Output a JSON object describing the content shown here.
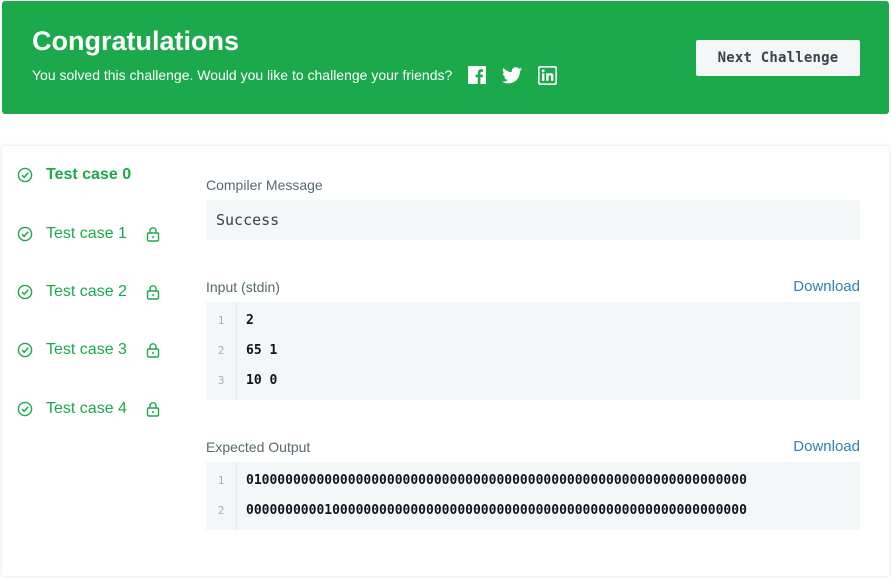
{
  "banner": {
    "title": "Congratulations",
    "subtitle": "You solved this challenge. Would you like to challenge your friends?",
    "social_icons": [
      "facebook-icon",
      "twitter-icon",
      "linkedin-icon"
    ],
    "next_button": "Next Challenge",
    "bg_color": "#1ba94c"
  },
  "test_cases": [
    {
      "label": "Test case 0",
      "active": true,
      "locked": false
    },
    {
      "label": "Test case 1",
      "active": false,
      "locked": true
    },
    {
      "label": "Test case 2",
      "active": false,
      "locked": true
    },
    {
      "label": "Test case 3",
      "active": false,
      "locked": true
    },
    {
      "label": "Test case 4",
      "active": false,
      "locked": true
    }
  ],
  "compiler": {
    "label": "Compiler Message",
    "message": "Success"
  },
  "input": {
    "label": "Input (stdin)",
    "download": "Download",
    "lines": [
      {
        "n": "1",
        "text": "2"
      },
      {
        "n": "2",
        "text": "65 1"
      },
      {
        "n": "3",
        "text": "10 0"
      }
    ]
  },
  "expected": {
    "label": "Expected Output",
    "download": "Download",
    "lines": [
      {
        "n": "1",
        "text": "0100000000000000000000000000000000000000000000000000000000000000"
      },
      {
        "n": "2",
        "text": "0000000000100000000000000000000000000000000000000000000000000000"
      }
    ]
  },
  "colors": {
    "accent_green": "#1ba94c",
    "link_blue": "#2a80b9",
    "code_bg": "#f3f7f7"
  }
}
